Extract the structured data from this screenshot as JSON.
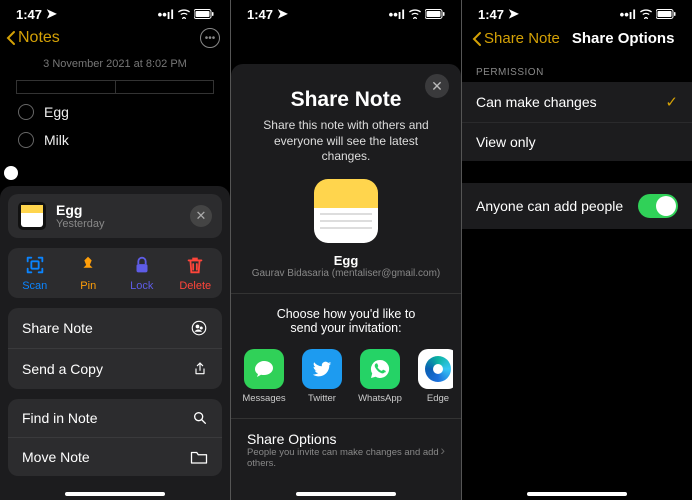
{
  "status": {
    "time": "1:47",
    "location_glyph": "➤",
    "signal_glyph": "📶",
    "wifi_glyph": "📡",
    "battery_glyph": "🔋"
  },
  "screen1": {
    "back_label": "Notes",
    "timestamp": "3 November 2021 at 8:02 PM",
    "items": [
      "Egg",
      "Milk"
    ],
    "sheet": {
      "title": "Egg",
      "subtitle": "Yesterday",
      "actions": {
        "scan": "Scan",
        "pin": "Pin",
        "lock": "Lock",
        "delete": "Delete"
      },
      "rows": {
        "share_note": "Share Note",
        "send_copy": "Send a Copy",
        "find_in_note": "Find in Note",
        "move_note": "Move Note"
      }
    }
  },
  "screen2": {
    "title": "Share Note",
    "description": "Share this note with others and everyone will see the latest changes.",
    "note_name": "Egg",
    "note_owner": "Gaurav Bidasaria (mentaliser@gmail.com)",
    "invite_prompt": "Choose how you'd like to send your invitation:",
    "apps": {
      "messages": "Messages",
      "twitter": "Twitter",
      "whatsapp": "WhatsApp",
      "edge": "Edge"
    },
    "share_options": {
      "title": "Share Options",
      "subtitle": "People you invite can make changes and add others."
    }
  },
  "screen3": {
    "back_label": "Share Note",
    "title": "Share Options",
    "permission_header": "Permission",
    "perm_can_change": "Can make changes",
    "perm_view_only": "View only",
    "anyone_add": "Anyone can add people"
  }
}
